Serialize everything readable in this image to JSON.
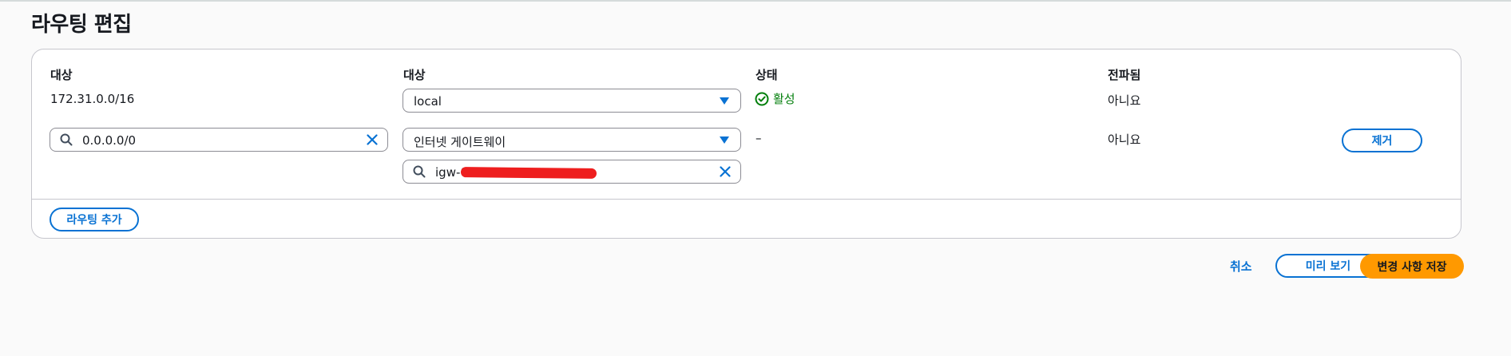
{
  "page": {
    "title": "라우팅 편집"
  },
  "columns": {
    "destination": "대상",
    "target": "대상",
    "status": "상태",
    "propagated": "전파됨"
  },
  "routes": [
    {
      "destination": "172.31.0.0/16",
      "target": "local",
      "status": "활성",
      "propagated": "아니요"
    },
    {
      "destination": "0.0.0.0/0",
      "target": "인터넷 게이트웨이",
      "target_search": "igw-0",
      "status": "–",
      "propagated": "아니요",
      "remove_label": "제거"
    }
  ],
  "add_route_label": "라우팅 추가",
  "footer": {
    "cancel": "취소",
    "preview": "미리 보기",
    "save": "변경 사항 저장"
  },
  "colors": {
    "accent": "#0972d3",
    "success": "#037f0c",
    "primary": "#ff9900"
  },
  "icons": [
    "search-icon",
    "clear-icon",
    "caret-down-icon",
    "status-success-icon"
  ]
}
